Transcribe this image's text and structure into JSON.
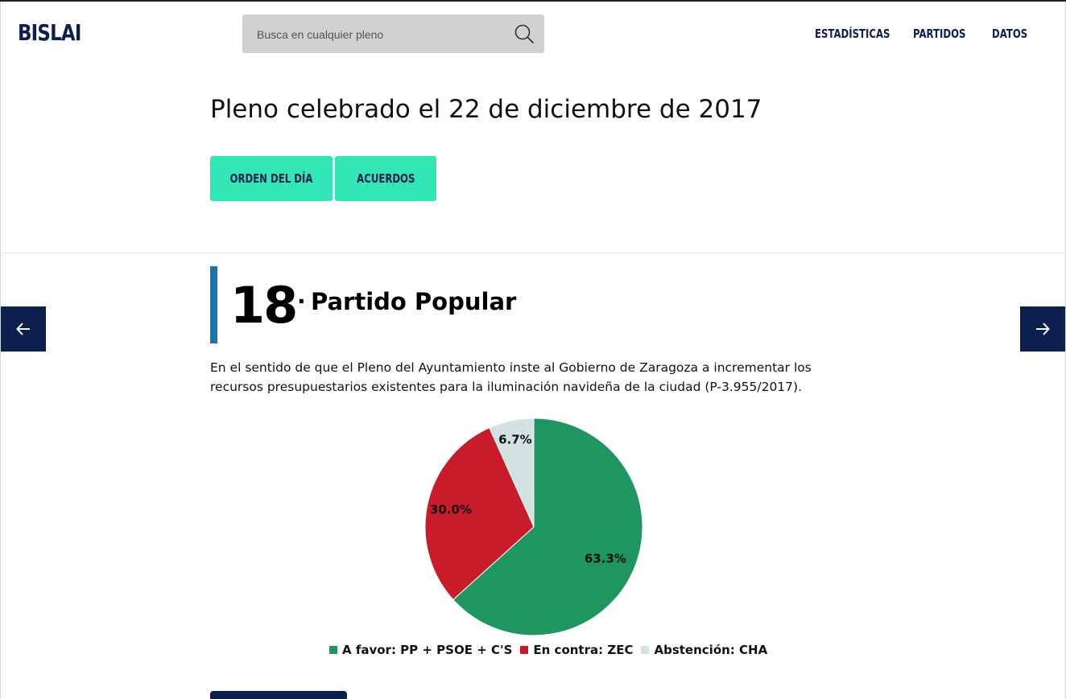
{
  "header": {
    "logo": "BISLAI",
    "search": {
      "placeholder": "Busca en cualquier pleno",
      "value": ""
    },
    "nav": [
      "ESTADÍSTICAS",
      "PARTIDOS",
      "DATOS"
    ]
  },
  "pleno": {
    "title": "Pleno celebrado el 22 de diciembre de 2017",
    "tabs": [
      "ORDEN DEL DÍA",
      "ACUERDOS"
    ]
  },
  "item": {
    "number": "18",
    "separator": "·",
    "party": "Partido Popular",
    "description": "En el sentido de que el Pleno del Ayuntamiento inste al Gobierno de Zaragoza a incrementar los recursos presupuestarios existentes para la iluminación navideña de la ciudad (P-3.955/2017)."
  },
  "icons": {
    "search": "search-icon",
    "prev": "arrow-left-icon",
    "next": "arrow-right-icon"
  },
  "colors": {
    "brand": "#0d1f4f",
    "accent": "#33e6b5",
    "item_bar": "#1676b5",
    "favor": "#1f9660",
    "contra": "#c91c2b",
    "abstencion": "#d3e1e1"
  },
  "chart_data": {
    "type": "pie",
    "labels": [
      "A favor: PP + PSOE + C'S",
      "En contra: ZEC",
      "Abstención: CHA"
    ],
    "values": [
      63.3,
      30.0,
      6.7
    ],
    "value_labels": [
      "63.3%",
      "30.0%",
      "6.7%"
    ],
    "colors": [
      "#1f9660",
      "#c91c2b",
      "#d3e1e1"
    ],
    "legend": "bottom",
    "start_angle": "top, clockwise"
  }
}
